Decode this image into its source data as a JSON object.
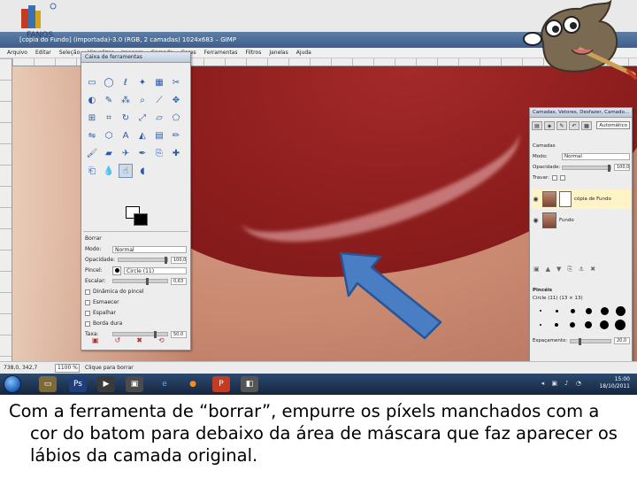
{
  "window": {
    "title": "[cópia do Fundo] (importada)-3.0 (RGB, 2 camadas) 1024x683 – GIMP",
    "menu": [
      "Arquivo",
      "Editar",
      "Seleção",
      "Visualizar",
      "Imagem",
      "Camada",
      "Cores",
      "Ferramentas",
      "Filtros",
      "Janelas",
      "Ajuda"
    ]
  },
  "toolbox": {
    "title": "Caixa de ferramentas",
    "options": {
      "header": "Borrar",
      "mode_label": "Modo:",
      "mode_value": "Normal",
      "opacity_label": "Opacidade:",
      "opacity_value": "100,0",
      "brush_label": "Pincel:",
      "brush_value": "Circle (11)",
      "scale_label": "Escalar:",
      "scale_value": "0,63",
      "dynamics_label": "Dinâmica do pincel",
      "fade_label": "Esmaecer",
      "jitter_label": "Espalhar",
      "hard_label": "Borda dura",
      "rate_label": "Taxa:",
      "rate_value": "50,0"
    }
  },
  "layers_panel": {
    "title": "Camadas, Vetores, Desfazer, Camado...",
    "auto_label": "Automático",
    "section": "Camadas",
    "mode_label": "Modo:",
    "mode_value": "Normal",
    "opacity_label": "Opacidade:",
    "opacity_value": "100,0",
    "lock_label": "Travar:",
    "layers": [
      {
        "name": "cópia de Fundo"
      },
      {
        "name": "Fundo"
      }
    ],
    "brushes_section": "Pincéis",
    "brush_name": "Circle (11) (13 × 13)",
    "spacing_label": "Espaçamento:",
    "spacing_value": "20,0"
  },
  "statusbar": {
    "coords": "738,0, 342,7",
    "zoom": "1100 %",
    "message": "Clique para borrar"
  },
  "tray": {
    "time": "15:00",
    "date": "18/10/2011"
  },
  "logo_left": {
    "text": "FANOS"
  },
  "caption": "Com a ferramenta de “borrar”, empurre os píxels manchados com a cor do batom para debaixo da área de máscara que faz aparecer os lábios da camada original.",
  "colors": {
    "arrow_fill": "#4a7ec4",
    "arrow_stroke": "#2a5592",
    "lip": "#8f1e1e",
    "skin": "#c98870"
  }
}
